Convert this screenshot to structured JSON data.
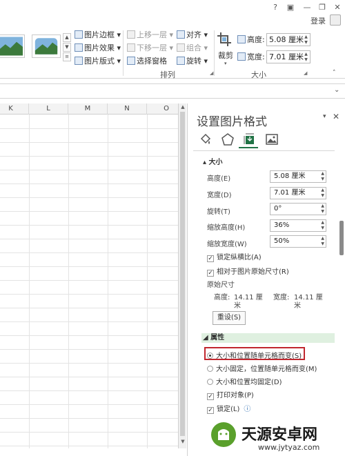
{
  "window": {
    "help": "?",
    "ribbon_display": "▣",
    "minimize": "—",
    "restore": "❐",
    "close": "✕",
    "login": "登录"
  },
  "ribbon": {
    "picture_border": "图片边框 ▾",
    "picture_effects": "图片效果 ▾",
    "picture_layout": "图片版式 ▾",
    "bring_forward": "上移一层 ▾",
    "send_backward": "下移一层 ▾",
    "selection_pane": "选择窗格",
    "align": "对齐 ▾",
    "group": "组合 ▾",
    "rotate": "旋转 ▾",
    "arrange_label": "排列",
    "crop": "裁剪",
    "height_label": "高度:",
    "height_value": "5.08 厘米",
    "width_label": "宽度:",
    "width_value": "7.01 厘米",
    "size_label": "大小"
  },
  "grid": {
    "columns": [
      "K",
      "L",
      "M",
      "N",
      "O"
    ]
  },
  "pane": {
    "title": "设置图片格式",
    "dropdown": "▾",
    "close": "✕",
    "tabs": [
      "fill-line-icon",
      "effects-icon",
      "size-properties-icon",
      "picture-icon"
    ],
    "size_section": "▴ 大小",
    "height_label": "高度(E)",
    "height_value": "5.08 厘米",
    "width_label": "宽度(D)",
    "width_value": "7.01 厘米",
    "rotation_label": "旋转(T)",
    "rotation_value": "0°",
    "scale_height_label": "缩放高度(H)",
    "scale_height_value": "36%",
    "scale_width_label": "缩放宽度(W)",
    "scale_width_value": "50%",
    "lock_aspect": "锁定纵横比(A)",
    "relative_original": "相对于图片原始尺寸(R)",
    "original_size": "原始尺寸",
    "orig_height_label": "高度:",
    "orig_height_value": "14.11 厘",
    "orig_height_unit": "米",
    "orig_width_label": "宽度:",
    "orig_width_value": "14.11 厘",
    "orig_width_unit": "米",
    "reset": "重设(S)",
    "properties_section": "◢ 属性",
    "opt_move_size": "大小和位置随单元格而变(S)",
    "opt_move_no_size": "大小固定，位置随单元格而变(M)",
    "opt_fixed": "大小和位置均固定(D)",
    "print_object": "打印对象(P)",
    "locked": "锁定(L)",
    "info": "ⓘ"
  },
  "watermark": {
    "name": "天源安卓网",
    "url": "www.jytyaz.com"
  }
}
